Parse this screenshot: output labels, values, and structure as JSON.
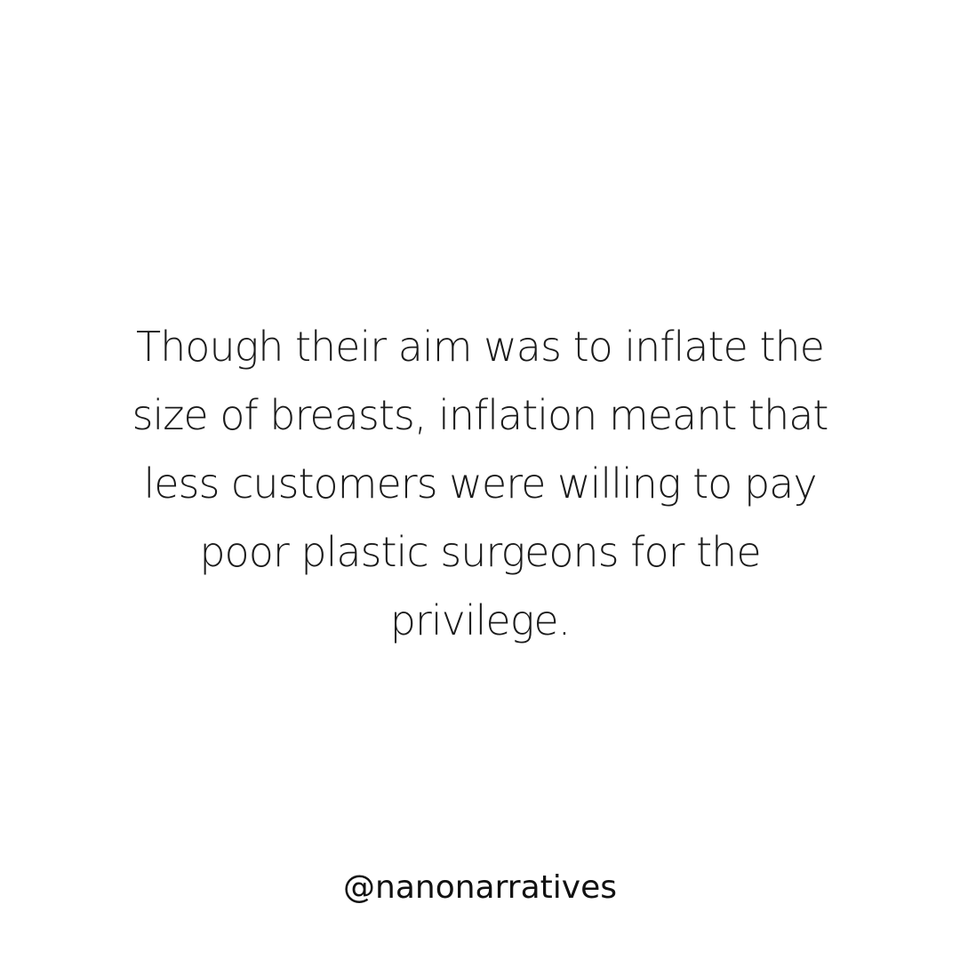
{
  "post": {
    "quote_lines": [
      "Though their aim was to inflate the",
      "size of breasts, inflation meant that",
      "less customers were willing to pay",
      "poor plastic surgeons for the",
      "privilege."
    ],
    "handle": "@nanonarratives"
  },
  "colors": {
    "background": "#ffffff",
    "text": "#1a1a1a"
  }
}
